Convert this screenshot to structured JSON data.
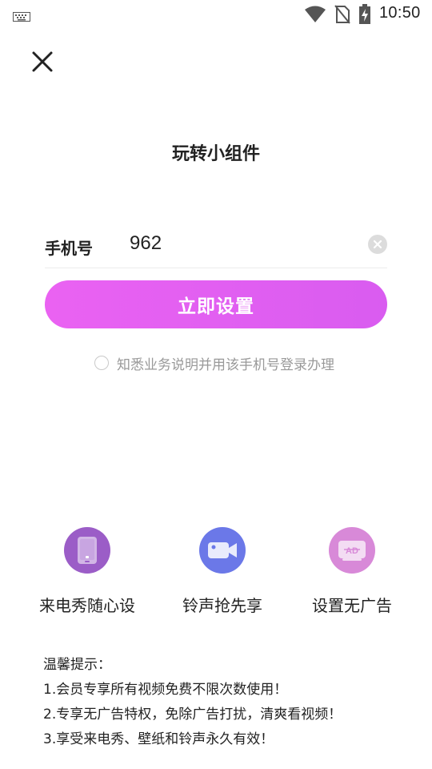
{
  "status_bar": {
    "time": "10:50",
    "icons": [
      "keyboard-icon",
      "wifi-icon",
      "no-sim-icon",
      "battery-charging-icon"
    ]
  },
  "header": {
    "close_icon": "close-icon",
    "title": "玩转小组件"
  },
  "form": {
    "phone_label": "手机号",
    "phone_value": "962",
    "clear_icon": "clear-icon",
    "submit_label": "立即设置",
    "agreement_text": "知悉业务说明并用该手机号登录办理"
  },
  "features": [
    {
      "label": "来电秀随心设",
      "icon": "phone-icon",
      "color": "#9b5dc7"
    },
    {
      "label": "铃声抢先享",
      "icon": "video-icon",
      "color": "#6b78e8"
    },
    {
      "label": "设置无广告",
      "icon": "no-ad-icon",
      "color": "#d889d8"
    }
  ],
  "tips": {
    "title": "温馨提示：",
    "items": [
      "1.会员专享所有视频免费不限次数使用！",
      "2.专享无广告特权，免除广告打扰，清爽看视频！",
      "3.享受来电秀、壁纸和铃声永久有效！"
    ]
  },
  "colors": {
    "accent": "#e25ff2",
    "text": "#222222",
    "muted": "#999999"
  }
}
